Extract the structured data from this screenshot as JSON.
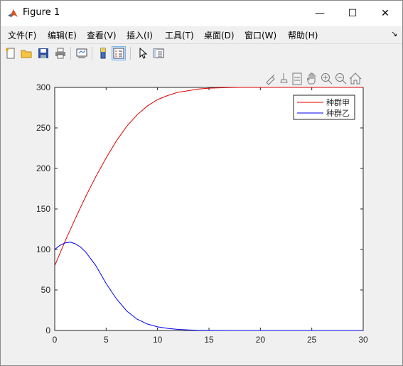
{
  "window": {
    "title": "Figure 1",
    "minimize_glyph": "—",
    "maximize_glyph": "☐",
    "close_glyph": "✕"
  },
  "menubar": {
    "items": [
      "文件(F)",
      "编辑(E)",
      "查看(V)",
      "插入(I)",
      "工具(T)",
      "桌面(D)",
      "窗口(W)",
      "帮助(H)"
    ],
    "dock_glyph": "↘"
  },
  "toolbar": {
    "buttons": [
      "new-figure-icon",
      "open-folder-icon",
      "save-icon",
      "print-icon",
      "link-plot-icon",
      "colorbar-icon",
      "legend-icon",
      "pointer-icon",
      "property-inspector-icon"
    ]
  },
  "axes_toolbar": [
    "brush-icon",
    "datatip-icon",
    "export-icon",
    "pan-hand-icon",
    "zoom-in-icon",
    "zoom-out-icon",
    "home-icon"
  ],
  "colors": {
    "series1": "#e00000",
    "series2": "#0000ee",
    "axes_bg": "#ffffff",
    "figure_bg": "#f0f0f0"
  },
  "chart_data": {
    "type": "line",
    "xlim": [
      0,
      30
    ],
    "ylim": [
      0,
      300
    ],
    "xticks": [
      0,
      5,
      10,
      15,
      20,
      25,
      30
    ],
    "yticks": [
      0,
      50,
      100,
      150,
      200,
      250,
      300
    ],
    "grid": false,
    "legend": {
      "location": "top-right"
    },
    "series": [
      {
        "name": "种群甲",
        "color": "#e00000",
        "x": [
          0,
          1,
          2,
          3,
          4,
          5,
          6,
          7,
          8,
          9,
          10,
          11,
          12,
          13,
          14,
          15,
          16,
          17,
          18,
          19,
          20,
          22,
          25,
          30
        ],
        "y": [
          80,
          110,
          138,
          165,
          190,
          213,
          234,
          252,
          266,
          277,
          285,
          290,
          294,
          296,
          298,
          299,
          299.5,
          299.8,
          300,
          300,
          300,
          300,
          300,
          300
        ]
      },
      {
        "name": "种群乙",
        "color": "#0000ee",
        "x": [
          0,
          0.5,
          1,
          1.5,
          2,
          2.5,
          3,
          4,
          5,
          6,
          7,
          8,
          9,
          10,
          11,
          12,
          13,
          14,
          15,
          17,
          20,
          25,
          30
        ],
        "y": [
          100,
          105,
          108,
          109,
          107,
          103,
          97,
          80,
          58,
          39,
          24,
          14,
          8,
          4.5,
          2.5,
          1.3,
          0.7,
          0.3,
          0.1,
          0,
          0,
          0,
          0
        ]
      }
    ]
  }
}
